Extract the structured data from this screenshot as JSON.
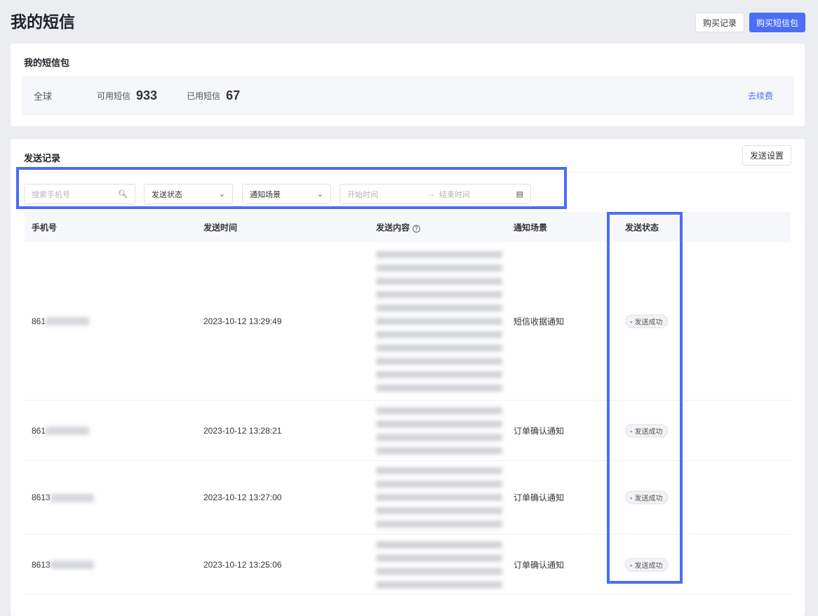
{
  "header": {
    "title": "我的短信",
    "purchase_history": "购买记录",
    "buy_package": "购买短信包"
  },
  "package": {
    "title": "我的短信包",
    "region": "全球",
    "available_label": "可用短信",
    "available": "933",
    "used_label": "已用短信",
    "used": "67",
    "renew": "去续费"
  },
  "records": {
    "title": "发送记录",
    "settings": "发送设置",
    "filters": {
      "phone_placeholder": "搜索手机号",
      "status": "发送状态",
      "scene": "通知场景",
      "start_placeholder": "开始时间",
      "arrow": "→",
      "end_placeholder": "结束时间"
    },
    "columns": [
      "手机号",
      "发送时间",
      "发送内容",
      "通知场景",
      "发送状态"
    ],
    "rows": [
      {
        "phone": "861",
        "time": "2023-10-12 13:29:49",
        "scene": "短信收据通知",
        "status": "发送成功"
      },
      {
        "phone": "861",
        "time": "2023-10-12 13:28:21",
        "scene": "订单确认通知",
        "status": "发送成功"
      },
      {
        "phone": "8613",
        "time": "2023-10-12 13:27:00",
        "scene": "订单确认通知",
        "status": "发送成功"
      },
      {
        "phone": "8613",
        "time": "2023-10-12 13:25:06",
        "scene": "订单确认通知",
        "status": "发送成功"
      }
    ]
  },
  "colors": {
    "accent": "#4c6ef5"
  }
}
